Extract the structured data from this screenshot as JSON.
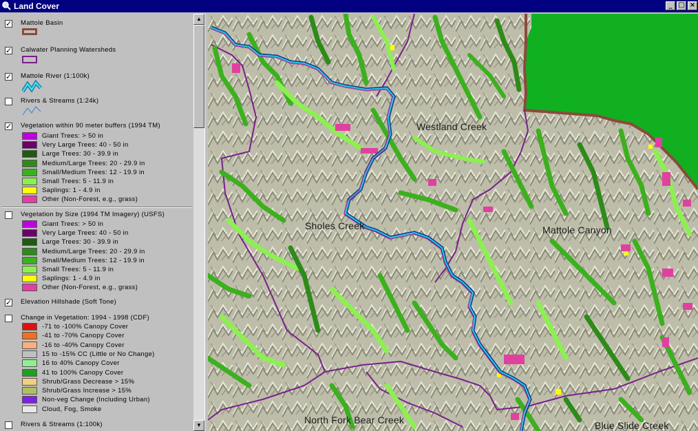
{
  "window": {
    "title": "Land Cover",
    "buttons": [
      "_",
      "□",
      "×"
    ]
  },
  "toc": {
    "mattole_basin": {
      "label": "Mattole Basin",
      "checked": true
    },
    "calwater": {
      "label": "Calwater Planning Watersheds",
      "checked": true
    },
    "mattole_river": {
      "label": "Mattole River (1:100k)",
      "checked": true
    },
    "rivers_streams_24k": {
      "label": "Rivers & Streams (1:24k)",
      "checked": false
    },
    "veg_buffers": {
      "label": "Vegetation within 90 meter buffers (1994 TM)",
      "checked": true,
      "items": [
        {
          "label": "Giant Trees: > 50 in",
          "color": "#c000e0"
        },
        {
          "label": "Very Large Trees: 40 - 50 in",
          "color": "#6a006a"
        },
        {
          "label": "Large Trees: 30 - 39.9 in",
          "color": "#1f5a10"
        },
        {
          "label": "Medium/Large Trees: 20 - 29.9 in",
          "color": "#2e8b1a"
        },
        {
          "label": "Small/Medium Trees: 12 - 19.9 in",
          "color": "#3cb01e"
        },
        {
          "label": "Small Trees: 5 - 11.9 in",
          "color": "#8cf050"
        },
        {
          "label": "Saplings: 1 - 4.9 in",
          "color": "#ffff00"
        },
        {
          "label": "Other (Non-Forest, e.g., grass)",
          "color": "#e040a0"
        }
      ]
    },
    "veg_size": {
      "label": "Vegetation by Size (1994 TM Imagery) (USFS)",
      "checked": false,
      "items": [
        {
          "label": "Giant Trees: > 50 in",
          "color": "#c000e0"
        },
        {
          "label": "Very Large Trees: 40 - 50 in",
          "color": "#6a006a"
        },
        {
          "label": "Large Trees: 30 - 39.9 in",
          "color": "#1f5a10"
        },
        {
          "label": "Medium/Large Trees: 20 - 29.9 in",
          "color": "#2e8b1a"
        },
        {
          "label": "Small/Medium Trees: 12 - 19.9 in",
          "color": "#3cb01e"
        },
        {
          "label": "Small Trees: 5 - 11.9 in",
          "color": "#8cf050"
        },
        {
          "label": "Saplings: 1 - 4.9 in",
          "color": "#ffff00"
        },
        {
          "label": "Other (Non-Forest, e.g., grass)",
          "color": "#e040a0"
        }
      ]
    },
    "hillshade": {
      "label": "Elevation Hillshade (Soft Tone)",
      "checked": true
    },
    "change": {
      "label": "Change in Vegetation: 1994 - 1998 (CDF)",
      "checked": false,
      "items": [
        {
          "label": "-71 to -100% Canopy Cover",
          "color": "#e01010"
        },
        {
          "label": "-41 to -70% Canopy Cover",
          "color": "#f07020"
        },
        {
          "label": "-16 to -40% Canopy Cover",
          "color": "#f8b080"
        },
        {
          "label": "15 to -15% CC (Little or No Change)",
          "color": "#c0c0c0"
        },
        {
          "label": "16 to 40% Canopy Cover",
          "color": "#90f090"
        },
        {
          "label": "41 to 100% Canopy Cover",
          "color": "#20a020"
        },
        {
          "label": "Shrub/Grass Decrease > 15%",
          "color": "#f0d080"
        },
        {
          "label": "Shrub/Grass Increase > 15%",
          "color": "#b0c060"
        },
        {
          "label": "Non-veg Change (Including Urban)",
          "color": "#8020e0"
        },
        {
          "label": "Cloud, Fog, Smoke",
          "color": "#e8e8e8"
        }
      ]
    },
    "rivers_streams_100k": {
      "label": "Rivers & Streams (1:100k)",
      "checked": false
    }
  },
  "map": {
    "labels": {
      "westland": "Westland Creek",
      "sholes": "Sholes Creek",
      "mattole_canyon": "Mattole Canyon",
      "north_fork": "North Fork Bear Creek",
      "blue_slide": "Blue Slide Creek"
    },
    "colors": {
      "terrain": "#b9b9a6",
      "ocean_area": "#10b020",
      "basin_outline": "#8b4a3a",
      "watershed": "#7a1f8a",
      "river": "#30c8e8"
    }
  }
}
